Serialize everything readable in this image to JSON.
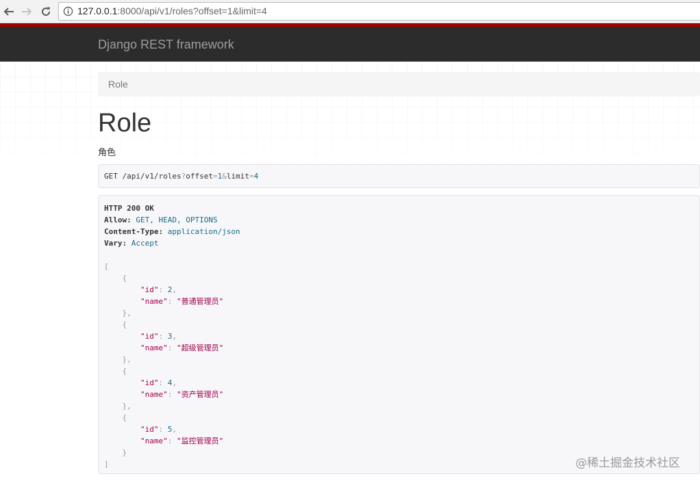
{
  "browser": {
    "url_host": "127.0.0.1",
    "url_rest": ":8000/api/v1/roles?offset=1&limit=4"
  },
  "navbar": {
    "brand": "Django REST framework"
  },
  "breadcrumb": {
    "items": [
      "Role"
    ]
  },
  "page": {
    "title": "Role",
    "description": "角色"
  },
  "request": {
    "method": "GET",
    "path": "/api/v1/roles",
    "query_q": "?",
    "query_offset_key": "offset",
    "query_eq1": "=",
    "query_offset_val": "1",
    "query_amp": "&",
    "query_limit_key": "limit",
    "query_eq2": "=",
    "query_limit_val": "4"
  },
  "response": {
    "status": "HTTP 200 OK",
    "headers": [
      {
        "key": "Allow:",
        "value": "GET, HEAD, OPTIONS"
      },
      {
        "key": "Content-Type:",
        "value": "application/json"
      },
      {
        "key": "Vary:",
        "value": "Accept"
      }
    ],
    "items": [
      {
        "id": "2",
        "name": "\"普通管理员\""
      },
      {
        "id": "3",
        "name": "\"超级管理员\""
      },
      {
        "id": "4",
        "name": "\"资产管理员\""
      },
      {
        "id": "5",
        "name": "\"监控管理员\""
      }
    ],
    "id_key": "\"id\"",
    "name_key": "\"name\""
  },
  "watermark": "@稀土掘金技术社区"
}
